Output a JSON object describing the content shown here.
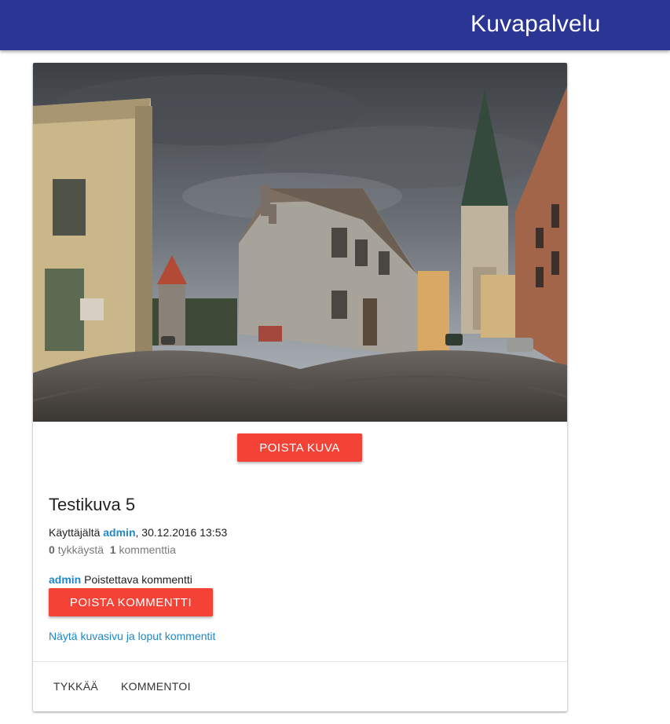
{
  "appbar": {
    "title": "Kuvapalvelu"
  },
  "post": {
    "delete_image_label": "POISTA KUVA",
    "title": "Testikuva 5",
    "meta_prefix": "Käyttäjältä",
    "author": "admin",
    "meta_suffix": ", 30.12.2016 13:53",
    "likes_count": "0",
    "likes_label": "tykkäystä",
    "comments_count": "1",
    "comments_label": "kommenttia",
    "comment": {
      "author": "admin",
      "text": "Poistettava kommentti"
    },
    "delete_comment_label": "POISTA KOMMENTTI",
    "view_all_link": "Näytä kuvasivu ja loput kommentit"
  },
  "actions": {
    "like_label": "TYKKÄÄ",
    "comment_label": "KOMMENTOI"
  },
  "photo": {
    "subject": "old-town-cobblestone-street-panorama"
  }
}
